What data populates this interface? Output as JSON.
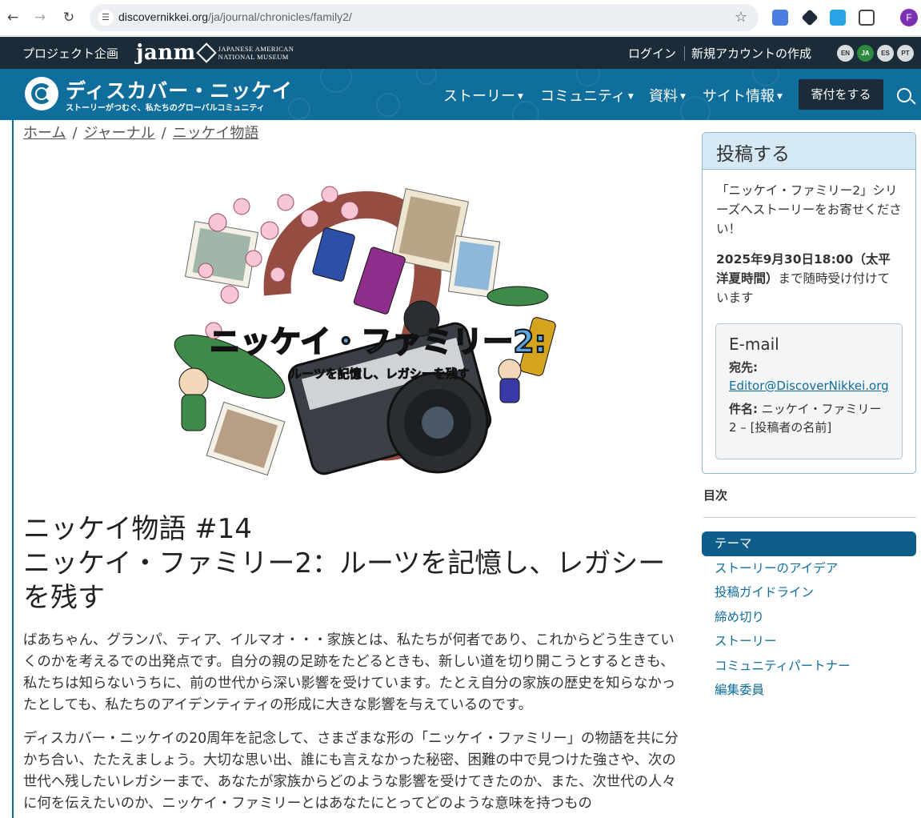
{
  "browser": {
    "url_domain": "discovernikkei.org",
    "url_path": "/ja/journal/chronicles/family2/",
    "profile_initial": "F"
  },
  "topbar": {
    "project": "プロジェクト企画",
    "janm_word": "janm",
    "janm_line1": "JAPANESE AMERICAN",
    "janm_line2": "NATIONAL MUSEUM",
    "login": "ログイン",
    "signup": "新規アカウントの作成",
    "languages": [
      "EN",
      "JA",
      "ES",
      "PT"
    ],
    "active_language": "JA"
  },
  "header": {
    "site_name": "ディスカバー・ニッケイ",
    "tagline": "ストーリーがつむぐ、私たちのグローバルコミュニティ",
    "nav": [
      "ストーリー",
      "コミュニティ",
      "資料",
      "サイト情報"
    ],
    "donate": "寄付をする"
  },
  "breadcrumb": [
    "ホーム",
    "ジャーナル",
    "ニッケイ物語"
  ],
  "illustration": {
    "title": "ニッケイ・ファミリー2:",
    "subtitle": "ルーツを記憶し、レガシーを残す"
  },
  "article": {
    "title_line1": "ニッケイ物語 #14",
    "title_line2": "ニッケイ・ファミリー2：ルーツを記憶し、レガシーを残す",
    "para1": "ばあちゃん、グランパ、ティア、イルマオ・・・家族とは、私たちが何者であり、これからどう生きていくのかを考えるでの出発点です。自分の親の足跡をたどるときも、新しい道を切り開こうとするときも、私たちは知らないうちに、前の世代から深い影響を受けています。たとえ自分の家族の歴史を知らなかったとしても、私たちのアイデンティティの形成に大きな影響を与えているのです。",
    "para2": "ディスカバー・ニッケイの20周年を記念して、さまざまな形の「ニッケイ・ファミリー」の物語を共に分かち合い、たたえましょう。大切な思い出、誰にも言えなかった秘密、困難の中で見つけた強さや、次の世代へ残したいレガシーまで、あなたが家族からどのような影響を受けてきたのか、また、次世代の人々に何を伝えたいのか、ニッケイ・ファミリーとはあなたにとってどのような意味を持つもの"
  },
  "sidebar": {
    "submit_title": "投稿する",
    "submit_text": "「ニッケイ・ファミリー2」シリーズへストーリーをお寄せください！",
    "deadline_bold": "2025年9月30日18:00（太平洋夏時間）",
    "deadline_rest": "まで随時受け付けています",
    "email_heading": "E-mail",
    "to_label": "宛先:",
    "to_address": "Editor@DiscoverNikkei.org",
    "subject_label": "件名:",
    "subject_value": "ニッケイ・ファミリー2 – [投稿者の名前]",
    "toc_title": "目次",
    "toc_items": [
      "テーマ",
      "ストーリーのアイデア",
      "投稿ガイドライン",
      "締め切り",
      "ストーリー",
      "コミュニティパートナー",
      "編集委員"
    ]
  },
  "colors": {
    "header_blue": "#0f6e9c",
    "dark_bar": "#1b2b37",
    "active_lang": "#2d8a3e"
  }
}
